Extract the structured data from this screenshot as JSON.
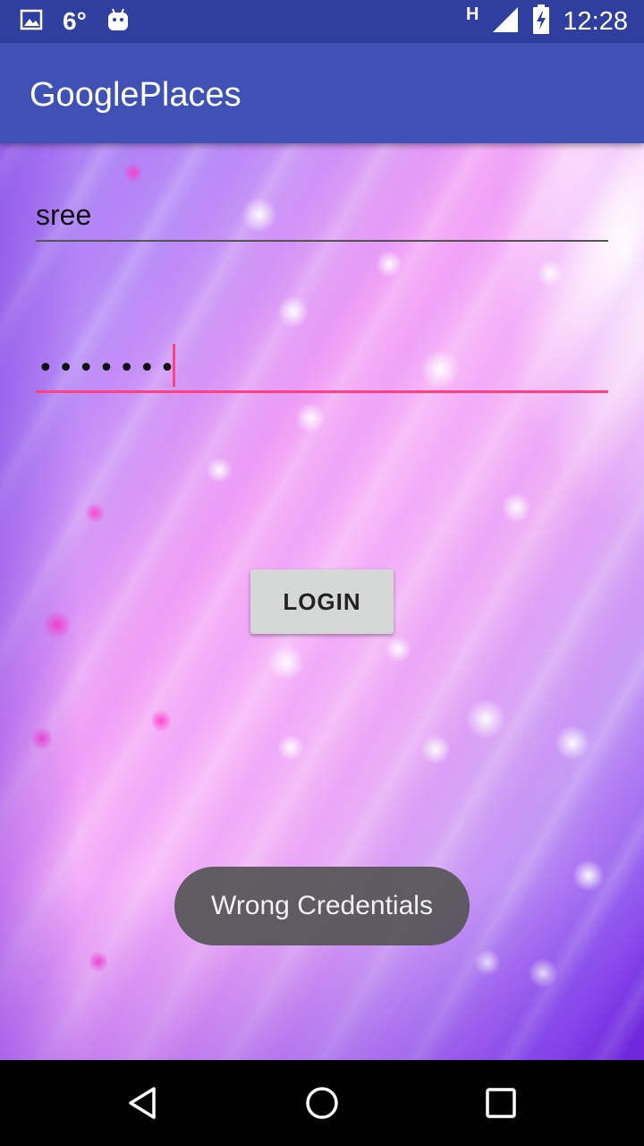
{
  "status_bar": {
    "temperature": "6°",
    "network": "H",
    "time": "12:28",
    "icons": [
      "image-notification-icon",
      "android-notification-icon",
      "signal-icon",
      "battery-charging-icon"
    ]
  },
  "app_bar": {
    "title": "GooglePlaces"
  },
  "login_form": {
    "username_value": "sree",
    "password_mask": "•••••••",
    "login_label": "LOGIN"
  },
  "toast": {
    "message": "Wrong Credentials"
  },
  "nav_bar": {
    "icons": [
      "back-icon",
      "home-icon",
      "recents-icon"
    ]
  },
  "colors": {
    "status_bar": "#303F9F",
    "app_bar": "#3F51B5",
    "accent": "#FF4081",
    "button": "#D6D7D7"
  }
}
